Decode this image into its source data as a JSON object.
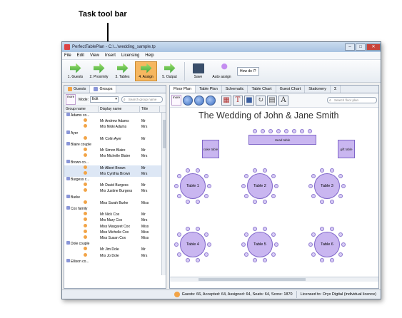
{
  "annotation": {
    "label": "Task tool bar"
  },
  "window": {
    "title": "PerfectTablePlan - C:\\...\\wedding_sample.tp"
  },
  "menu": [
    "File",
    "Edit",
    "View",
    "Insert",
    "Licensing",
    "Help"
  ],
  "toolbar": {
    "buttons": [
      {
        "label": "1. Guests"
      },
      {
        "label": "2. Proximity"
      },
      {
        "label": "3. Tables"
      },
      {
        "label": "4. Assign"
      },
      {
        "label": "5. Output"
      }
    ],
    "save_label": "Save",
    "auto_assign_label": "Auto assign",
    "how_label": "How do I?"
  },
  "left": {
    "tabs": [
      "Guests",
      "Groups"
    ],
    "more_label": "more",
    "mode_label": "Mode:",
    "mode_value": "Edit",
    "search_placeholder": "Search group name",
    "columns": [
      "Group name",
      "Display name",
      "Title"
    ],
    "rows": [
      {
        "group": "Adams co...",
        "name": "",
        "title": ""
      },
      {
        "group": "",
        "name": "Mr Andrew Adams",
        "title": "Mr"
      },
      {
        "group": "",
        "name": "Mrs Nikki Adams",
        "title": "Mrs"
      },
      {
        "group": "Ayer",
        "name": "",
        "title": ""
      },
      {
        "group": "",
        "name": "Mr Colin Ayer",
        "title": "Mr"
      },
      {
        "group": "Blaire couple",
        "name": "",
        "title": ""
      },
      {
        "group": "",
        "name": "Mr Simon Blaire",
        "title": "Mr"
      },
      {
        "group": "",
        "name": "Mrs Michelle Blaire",
        "title": "Mrs"
      },
      {
        "group": "Brown co...",
        "name": "",
        "title": ""
      },
      {
        "group": "",
        "name": "Mr Albert Brown",
        "title": "Mr"
      },
      {
        "group": "",
        "name": "Mrs Cynthia Brown",
        "title": "Mrs"
      },
      {
        "group": "Burgess c...",
        "name": "",
        "title": ""
      },
      {
        "group": "",
        "name": "Mr David Burgess",
        "title": "Mr"
      },
      {
        "group": "",
        "name": "Mrs Justine Burgess",
        "title": "Mrs"
      },
      {
        "group": "Burke",
        "name": "",
        "title": ""
      },
      {
        "group": "",
        "name": "Miss Sarah Burke",
        "title": "Miss"
      },
      {
        "group": "Cox family",
        "name": "",
        "title": ""
      },
      {
        "group": "",
        "name": "Mr Nick Cox",
        "title": "Mr"
      },
      {
        "group": "",
        "name": "Mrs Mary Cox",
        "title": "Mrs"
      },
      {
        "group": "",
        "name": "Miss Margaret Cox",
        "title": "Miss"
      },
      {
        "group": "",
        "name": "Miss Michelle Cox",
        "title": "Miss"
      },
      {
        "group": "",
        "name": "Miss Susan Cox",
        "title": "Miss"
      },
      {
        "group": "Dole couple",
        "name": "",
        "title": ""
      },
      {
        "group": "",
        "name": "Mr Jim Dole",
        "title": "Mr"
      },
      {
        "group": "",
        "name": "Mrs Jo Dole",
        "title": "Mrs"
      },
      {
        "group": "Ellison co...",
        "name": "",
        "title": ""
      }
    ]
  },
  "right": {
    "tabs": [
      "Floor Plan",
      "Table Plan",
      "Schematic",
      "Table Chart",
      "Guest Chart",
      "Stationery",
      "Σ"
    ],
    "more_label": "more",
    "search_placeholder": "Search floor plan",
    "plan_title": "The Wedding of John & Jane Smith",
    "rect_tables": [
      "cake table",
      "Head table",
      "gift table"
    ],
    "round_tables": [
      "Table 1",
      "Table 2",
      "Table 3",
      "Table 4",
      "Table 5",
      "Table 6"
    ]
  },
  "status": {
    "summary": "Guests: 66, Accepted: 64, Assigned: 64, Seats: 64, Score: 1870",
    "license": "Licensed to: Oryx Digital (individual licence)"
  }
}
